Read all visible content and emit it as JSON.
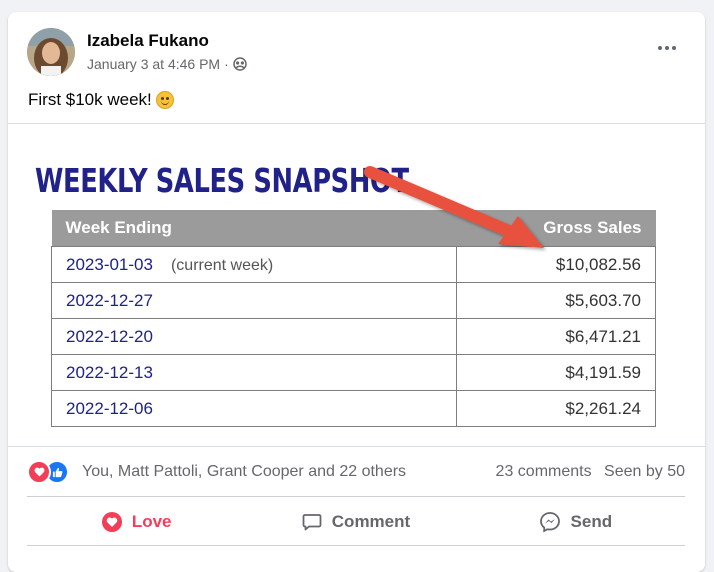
{
  "post": {
    "author": "Izabela Fukano",
    "timestamp": "January 3 at 4:46 PM",
    "separator": "·",
    "audience_icon": "friends-icon",
    "more_icon": "more-horizontal-icon",
    "caption": "First $10k week!",
    "caption_emoji": "smiling-face-emoji"
  },
  "image": {
    "title": "WEEKLY SALES SNAPSHOT",
    "columns": [
      "Week Ending",
      "Gross Sales"
    ],
    "rows": [
      {
        "week": "2023-01-03",
        "note": "(current week)",
        "sales": "$10,082.56"
      },
      {
        "week": "2022-12-27",
        "note": "",
        "sales": "$5,603.70"
      },
      {
        "week": "2022-12-20",
        "note": "",
        "sales": "$6,471.21"
      },
      {
        "week": "2022-12-13",
        "note": "",
        "sales": "$4,191.59"
      },
      {
        "week": "2022-12-06",
        "note": "",
        "sales": "$2,261.24"
      }
    ],
    "title_color": "#20228a",
    "arrow_color": "#e8513c"
  },
  "stats": {
    "reactions": [
      "love-icon",
      "like-icon"
    ],
    "reaction_text": "You, Matt Pattoli, Grant Cooper and 22 others",
    "comments": "23 comments",
    "seen": "Seen by 50"
  },
  "actions": {
    "love": "Love",
    "comment": "Comment",
    "send": "Send"
  },
  "colors": {
    "love": "#f33e58",
    "like": "#1877f2",
    "muted_text": "#65676b"
  }
}
